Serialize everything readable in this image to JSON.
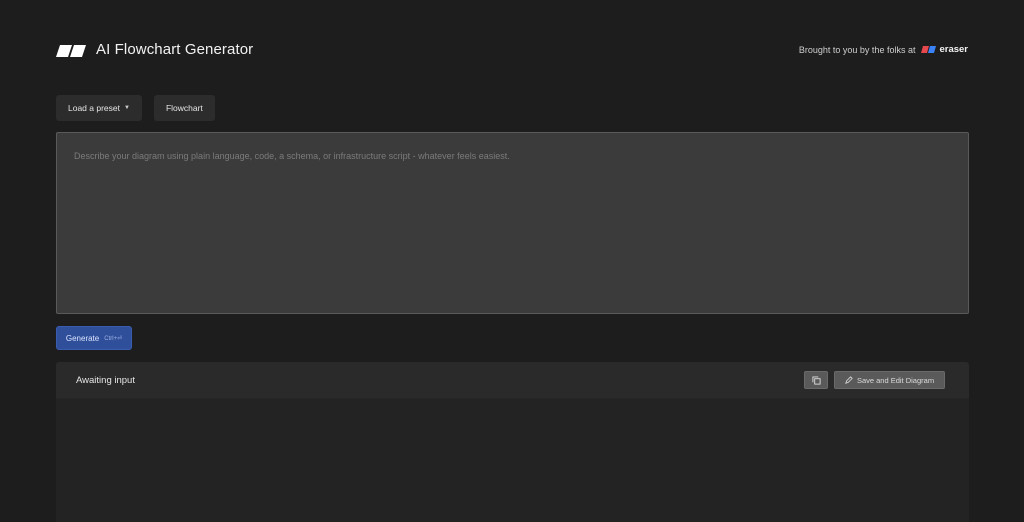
{
  "header": {
    "title": "AI Flowchart Generator",
    "credit_text": "Brought to you by the folks at",
    "brand_name": "eraser"
  },
  "toolbar": {
    "preset_label": "Load a preset",
    "type_label": "Flowchart"
  },
  "prompt": {
    "placeholder": "Describe your diagram using plain language, code, a schema, or infrastructure script - whatever feels easiest.",
    "value": ""
  },
  "generate": {
    "label": "Generate",
    "shortcut": "Ctrl+⏎"
  },
  "output": {
    "status": "Awaiting input",
    "copy_icon": "copy-icon",
    "save_label": "Save and Edit Diagram"
  },
  "colors": {
    "background": "#1d1d1d",
    "accent": "#2f4f9a",
    "brand_red": "#e5484d",
    "brand_blue": "#3b82f6"
  }
}
